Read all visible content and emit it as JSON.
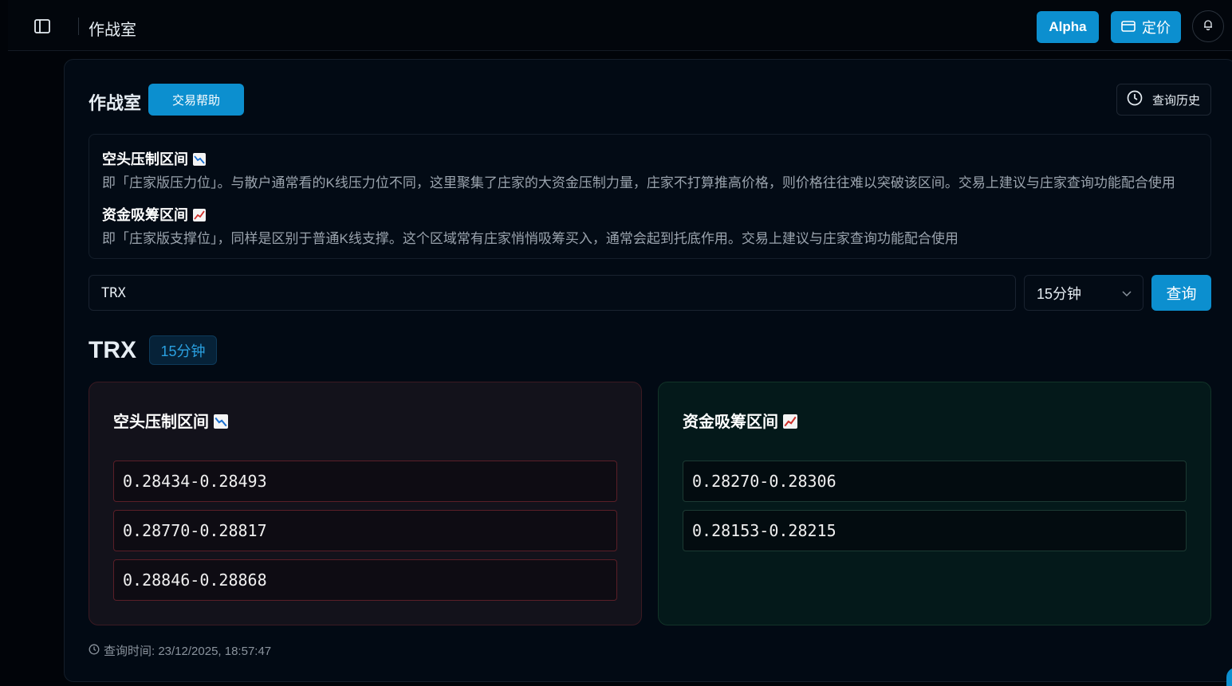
{
  "topbar": {
    "title": "作战室",
    "alpha_label": "Alpha",
    "pricing_label": "定价"
  },
  "page": {
    "title": "作战室",
    "help_label": "交易帮助",
    "history_label": "查询历史"
  },
  "info": {
    "short_title": "空头压制区间",
    "short_desc": "即「庄家版压力位」。与散户通常看的K线压力位不同，这里聚集了庄家的大资金压制力量，庄家不打算推高价格，则价格往往难以突破该区间。交易上建议与庄家查询功能配合使用",
    "long_title": "资金吸筹区间",
    "long_desc": "即「庄家版支撑位」，同样是区别于普通K线支撑。这个区域常有庄家悄悄吸筹买入，通常会起到托底作用。交易上建议与庄家查询功能配合使用"
  },
  "search": {
    "symbol_value": "TRX",
    "interval_value": "15分钟",
    "query_label": "查询"
  },
  "result": {
    "symbol": "TRX",
    "interval": "15分钟",
    "short_panel_title": "空头压制区间",
    "long_panel_title": "资金吸筹区间",
    "short_ranges": [
      "0.28434-0.28493",
      "0.28770-0.28817",
      "0.28846-0.28868"
    ],
    "long_ranges": [
      "0.28270-0.28306",
      "0.28153-0.28215"
    ],
    "query_time": "查询时间: 23/12/2025, 18:57:47"
  },
  "colors": {
    "accent": "#0c8fcf",
    "background": "#010409",
    "short_border": "#5a1f28",
    "long_border": "#1c3a33"
  },
  "icons": [
    "sidebar-toggle-icon",
    "card-icon",
    "bell-icon",
    "clock-icon",
    "chevron-down-icon",
    "chart-decreasing-icon",
    "chart-increasing-icon"
  ]
}
